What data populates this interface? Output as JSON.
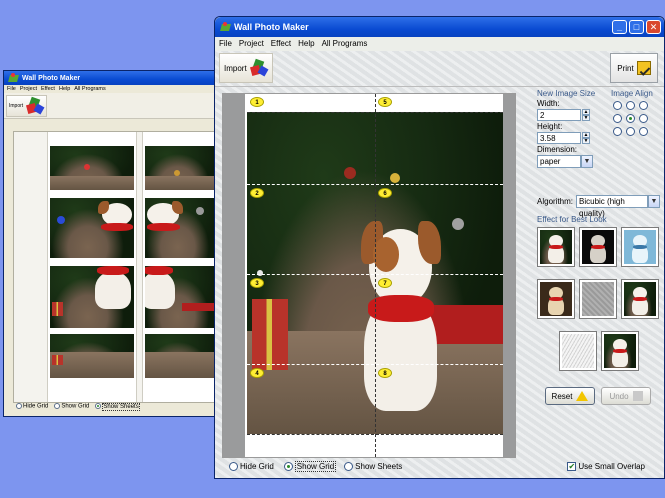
{
  "back_window": {
    "title": "Wall Photo Maker",
    "menu": [
      "File",
      "Project",
      "Effect",
      "Help",
      "All Programs"
    ],
    "import_label": "Import",
    "footer": {
      "hide_grid": "Hide Grid",
      "show_grid": "Show Grid",
      "show_sheets": "Show Sheets",
      "selected": "show_sheets"
    }
  },
  "main_window": {
    "title": "Wall Photo Maker",
    "menu": [
      "File",
      "Project",
      "Effect",
      "Help",
      "All Programs"
    ],
    "toolbar": {
      "import_label": "Import",
      "print_label": "Print"
    },
    "grid_numbers": [
      "1",
      "2",
      "3",
      "4",
      "5",
      "6",
      "7",
      "8"
    ],
    "footer": {
      "hide_grid": "Hide Grid",
      "show_grid": "Show Grid",
      "show_sheets": "Show Sheets",
      "selected": "show_grid",
      "use_small_overlap": "Use Small Overlap",
      "use_small_overlap_checked": true
    },
    "panel": {
      "new_image_size": "New Image Size",
      "width_label": "Width:",
      "width_value": "2",
      "height_label": "Height:",
      "height_value": "3.58",
      "dimension_label": "Dimension:",
      "dimension_value": "paper",
      "image_align": "Image Align",
      "align_selected": "center",
      "algorithm_label": "Algorithm:",
      "algorithm_value": "Bicubic (high quality)",
      "effect_title": "Effect for Best Look",
      "effects": [
        "normal",
        "dark",
        "blue",
        "warm",
        "emboss",
        "sepia",
        "sketch",
        "vivid"
      ],
      "reset_label": "Reset",
      "undo_label": "Undo"
    }
  },
  "colors": {
    "desktop": "#7d95ef",
    "title_bar": "#0a4bd2",
    "badge": "#ffee33",
    "accent_text": "#3a5a8a"
  }
}
